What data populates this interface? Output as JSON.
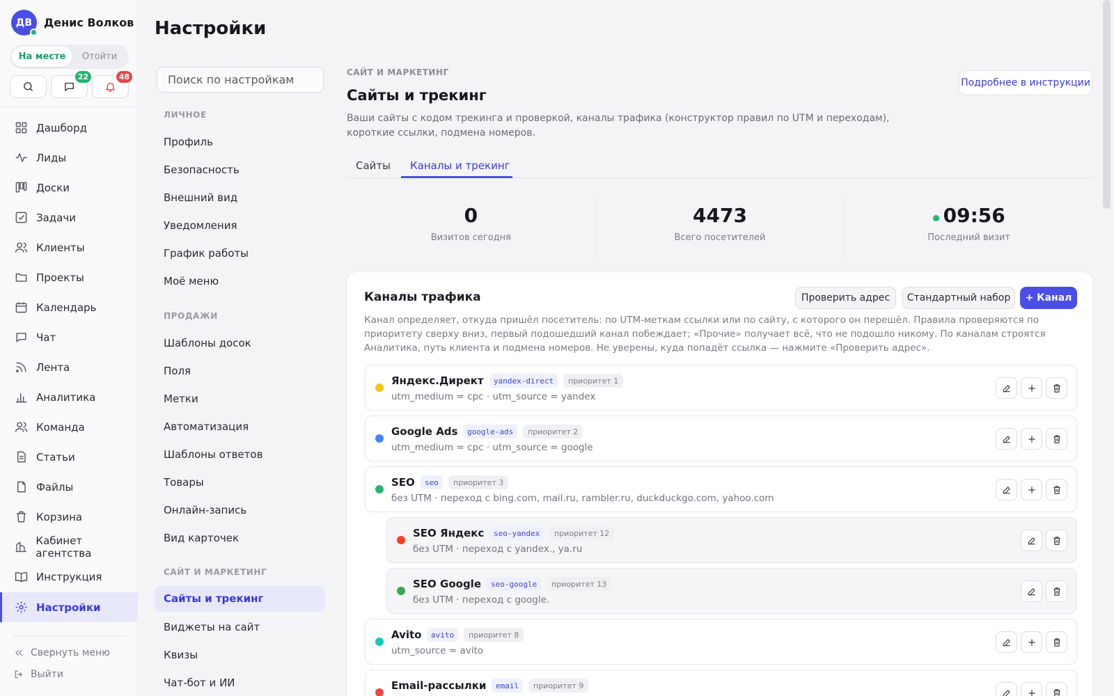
{
  "user": {
    "initials": "ДВ",
    "name": "Денис Волков"
  },
  "presence": {
    "on_label": "На месте",
    "off_label": "Отойти"
  },
  "quick_actions": {
    "messages_badge": "22",
    "notifications_badge": "48"
  },
  "nav": {
    "items": [
      {
        "label": "Дашборд",
        "icon": "dashboard-icon"
      },
      {
        "label": "Лиды",
        "icon": "activity-icon"
      },
      {
        "label": "Доски",
        "icon": "kanban-icon"
      },
      {
        "label": "Задачи",
        "icon": "task-icon"
      },
      {
        "label": "Клиенты",
        "icon": "users-icon"
      },
      {
        "label": "Проекты",
        "icon": "folder-icon"
      },
      {
        "label": "Календарь",
        "icon": "calendar-icon"
      },
      {
        "label": "Чат",
        "icon": "chat-icon"
      },
      {
        "label": "Лента",
        "icon": "rss-icon"
      },
      {
        "label": "Аналитика",
        "icon": "bar-chart-icon"
      },
      {
        "label": "Команда",
        "icon": "team-icon"
      },
      {
        "label": "Статьи",
        "icon": "article-icon"
      },
      {
        "label": "Файлы",
        "icon": "file-icon"
      },
      {
        "label": "Корзина",
        "icon": "trash-icon"
      },
      {
        "label": "Кабинет агентства",
        "icon": "building-icon"
      },
      {
        "label": "Инструкция",
        "icon": "book-icon"
      },
      {
        "label": "Настройки",
        "icon": "gear-icon"
      }
    ],
    "collapse_label": "Свернуть меню",
    "logout_label": "Выйти"
  },
  "page": {
    "title": "Настройки"
  },
  "settings_nav": {
    "search_placeholder": "Поиск по настройкам",
    "groups": [
      {
        "title": "ЛИЧНОЕ",
        "items": [
          "Профиль",
          "Безопасность",
          "Внешний вид",
          "Уведомления",
          "График работы",
          "Моё меню"
        ]
      },
      {
        "title": "ПРОДАЖИ",
        "items": [
          "Шаблоны досок",
          "Поля",
          "Метки",
          "Автоматизация",
          "Шаблоны ответов",
          "Товары",
          "Онлайн-запись",
          "Вид карточек"
        ]
      },
      {
        "title": "САЙТ И МАРКЕТИНГ",
        "items": [
          "Сайты и трекинг",
          "Виджеты на сайт",
          "Квизы",
          "Чат-бот и ИИ"
        ]
      }
    ],
    "active": "Сайты и трекинг"
  },
  "main": {
    "section": "САЙТ И МАРКЕТИНГ",
    "help_label": "Подробнее в инструкции",
    "title": "Сайты и трекинг",
    "description": "Ваши сайты с кодом трекинга и проверкой, каналы трафика (конструктор правил по UTM и переходам), короткие ссылки, подмена номеров.",
    "tabs": [
      {
        "label": "Сайты"
      },
      {
        "label": "Каналы и трекинг"
      }
    ],
    "active_tab": "Каналы и трекинг",
    "stats": [
      {
        "value": "0",
        "label": "Визитов сегодня"
      },
      {
        "value": "4473",
        "label": "Всего посетителей"
      },
      {
        "value": "09:56",
        "label": "Последний визит"
      }
    ]
  },
  "channels": {
    "title": "Каналы трафика",
    "check_label": "Проверить адрес",
    "preset_label": "Стандартный набор",
    "add_label": "+ Канал",
    "description": "Канал определяет, откуда пришёл посетитель: по UTM-меткам ссылки или по сайту, с которого он перешёл. Правила проверяются по приоритету сверху вниз, первый подошедший канал побеждает; «Прочие» получает всё, что не подошло никому. По каналам строятся Аналитика, путь клиента и подмена номеров. Не уверены, куда попадёт ссылка — нажмите «Проверить адрес».",
    "rows": [
      {
        "name": "Яндекс.Директ",
        "code": "yandex-direct",
        "priority": "приоритет 1",
        "rule": "utm_medium = cpc · utm_source = yandex",
        "color": "#f5c518",
        "nested": false
      },
      {
        "name": "Google Ads",
        "code": "google-ads",
        "priority": "приоритет 2",
        "rule": "utm_medium = cpc · utm_source = google",
        "color": "#4285f4",
        "nested": false
      },
      {
        "name": "SEO",
        "code": "seo",
        "priority": "приоритет 3",
        "rule": "без UTM · переход с bing.com, mail.ru, rambler.ru, duckduckgo.com, yahoo.com",
        "color": "#22b573",
        "nested": false
      },
      {
        "name": "SEO Яндекс",
        "code": "seo-yandex",
        "priority": "приоритет 12",
        "rule": "без UTM · переход с yandex., ya.ru",
        "color": "#fc3f1d",
        "nested": true
      },
      {
        "name": "SEO Google",
        "code": "seo-google",
        "priority": "приоритет 13",
        "rule": "без UTM · переход с google.",
        "color": "#34a853",
        "nested": true
      },
      {
        "name": "Avito",
        "code": "avito",
        "priority": "приоритет 8",
        "rule": "utm_source = avito",
        "color": "#14c8b4",
        "nested": false
      },
      {
        "name": "Email-рассылки",
        "code": "email",
        "priority": "приоритет 9",
        "rule": "",
        "color": "#e54848",
        "nested": false
      }
    ]
  },
  "colors": {
    "accent": "#4b4ee6",
    "online": "#22b573",
    "badge_red": "#e54848"
  }
}
